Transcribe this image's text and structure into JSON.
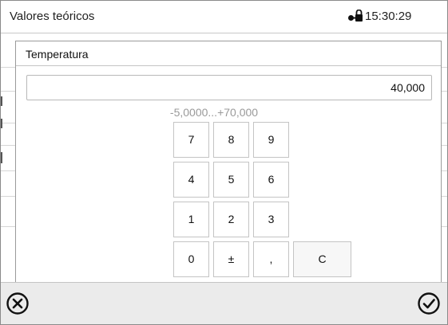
{
  "status_bar": {
    "title": "Valores teóricos",
    "time": "15:30:29",
    "lock_icon": "lock-key-icon"
  },
  "dialog": {
    "label": "Temperatura",
    "value": "40,000",
    "range": "-5,0000...+70,000"
  },
  "keypad": {
    "k7": "7",
    "k8": "8",
    "k9": "9",
    "k4": "4",
    "k5": "5",
    "k6": "6",
    "k1": "1",
    "k2": "2",
    "k3": "3",
    "k0": "0",
    "sign": "±",
    "comma": ",",
    "clear": "C"
  },
  "actions": {
    "cancel_icon": "circle-x-icon",
    "confirm_icon": "circle-check-icon"
  }
}
